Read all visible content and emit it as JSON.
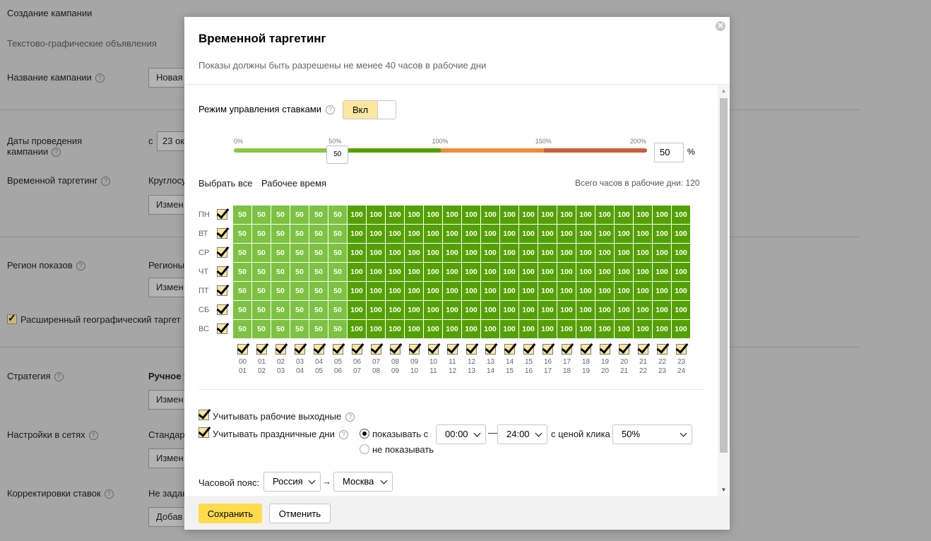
{
  "background": {
    "page_title": "Создание кампании",
    "ad_type": "Текстово-графические объявления",
    "campaign_name_label": "Название кампании",
    "campaign_name_value": "Новая",
    "dates_label_line1": "Даты проведения",
    "dates_label_line2": "кампании",
    "dates_from": "с",
    "dates_value": "23 ок",
    "targeting_label": "Временной таргетинг",
    "targeting_value": "Круглосу",
    "change_btn": "Измен",
    "region_label": "Регион показов",
    "region_value": "Регионы",
    "ext_geo_label": "Расширенный географический таргет",
    "strategy_label": "Стратегия",
    "strategy_value": "Ручное у",
    "networks_label": "Настройки в сетях",
    "networks_value": "Стандар",
    "bid_adj_label": "Корректировки ставок",
    "bid_adj_value": "Не задан",
    "add_btn": "Добав"
  },
  "modal": {
    "title": "Временной таргетинг",
    "subtitle": "Показы должны быть разрешены не менее 40 часов в рабочие дни",
    "close_icon": "close-icon",
    "bid_mode_label": "Режим управления ставками",
    "bid_mode_toggle": "Вкл",
    "slider": {
      "ticks": [
        "0%",
        "50%",
        "100%",
        "150%",
        "200%"
      ],
      "value": 50,
      "handle_label": "50",
      "input_value": "50",
      "unit": "%",
      "colors": [
        "#8cc63f",
        "#54a000",
        "#ee8c3b",
        "#cc5c3a"
      ]
    },
    "select_all": "Выбрать все",
    "work_time": "Рабочее время",
    "total_hours": "Всего часов в рабочие дни: 120",
    "days": [
      "ПН",
      "ВТ",
      "СР",
      "ЧТ",
      "ПТ",
      "СБ",
      "ВС"
    ],
    "hours_start": [
      "00",
      "01",
      "02",
      "03",
      "04",
      "05",
      "06",
      "07",
      "08",
      "09",
      "10",
      "11",
      "12",
      "13",
      "14",
      "15",
      "16",
      "17",
      "18",
      "19",
      "20",
      "21",
      "22",
      "23"
    ],
    "hours_end": [
      "01",
      "02",
      "03",
      "04",
      "05",
      "06",
      "07",
      "08",
      "09",
      "10",
      "11",
      "12",
      "13",
      "14",
      "15",
      "16",
      "17",
      "18",
      "19",
      "20",
      "21",
      "22",
      "23",
      "24"
    ],
    "grid_values": [
      [
        "50",
        "50",
        "50",
        "50",
        "50",
        "50",
        "100",
        "100",
        "100",
        "100",
        "100",
        "100",
        "100",
        "100",
        "100",
        "100",
        "100",
        "100",
        "100",
        "100",
        "100",
        "100",
        "100",
        "100"
      ],
      [
        "50",
        "50",
        "50",
        "50",
        "50",
        "50",
        "100",
        "100",
        "100",
        "100",
        "100",
        "100",
        "100",
        "100",
        "100",
        "100",
        "100",
        "100",
        "100",
        "100",
        "100",
        "100",
        "100",
        "100"
      ],
      [
        "50",
        "50",
        "50",
        "50",
        "50",
        "50",
        "100",
        "100",
        "100",
        "100",
        "100",
        "100",
        "100",
        "100",
        "100",
        "100",
        "100",
        "100",
        "100",
        "100",
        "100",
        "100",
        "100",
        "100"
      ],
      [
        "50",
        "50",
        "50",
        "50",
        "50",
        "50",
        "100",
        "100",
        "100",
        "100",
        "100",
        "100",
        "100",
        "100",
        "100",
        "100",
        "100",
        "100",
        "100",
        "100",
        "100",
        "100",
        "100",
        "100"
      ],
      [
        "50",
        "50",
        "50",
        "50",
        "50",
        "50",
        "100",
        "100",
        "100",
        "100",
        "100",
        "100",
        "100",
        "100",
        "100",
        "100",
        "100",
        "100",
        "100",
        "100",
        "100",
        "100",
        "100",
        "100"
      ],
      [
        "50",
        "50",
        "50",
        "50",
        "50",
        "50",
        "100",
        "100",
        "100",
        "100",
        "100",
        "100",
        "100",
        "100",
        "100",
        "100",
        "100",
        "100",
        "100",
        "100",
        "100",
        "100",
        "100",
        "100"
      ],
      [
        "50",
        "50",
        "50",
        "50",
        "50",
        "50",
        "100",
        "100",
        "100",
        "100",
        "100",
        "100",
        "100",
        "100",
        "100",
        "100",
        "100",
        "100",
        "100",
        "100",
        "100",
        "100",
        "100",
        "100"
      ]
    ],
    "consider_workdays": "Учитывать рабочие выходные",
    "consider_holidays": "Учитывать праздничные дни",
    "show_from": "показывать с",
    "time_from": "00:00",
    "dash": "—",
    "time_to": "24:00",
    "click_price_label": "с ценой клика",
    "click_price_value": "50%",
    "dont_show": "не показывать",
    "timezone_label": "Часовой пояс:",
    "country": "Россия",
    "arrow": "→",
    "city": "Москва",
    "save": "Сохранить",
    "cancel": "Отменить"
  }
}
